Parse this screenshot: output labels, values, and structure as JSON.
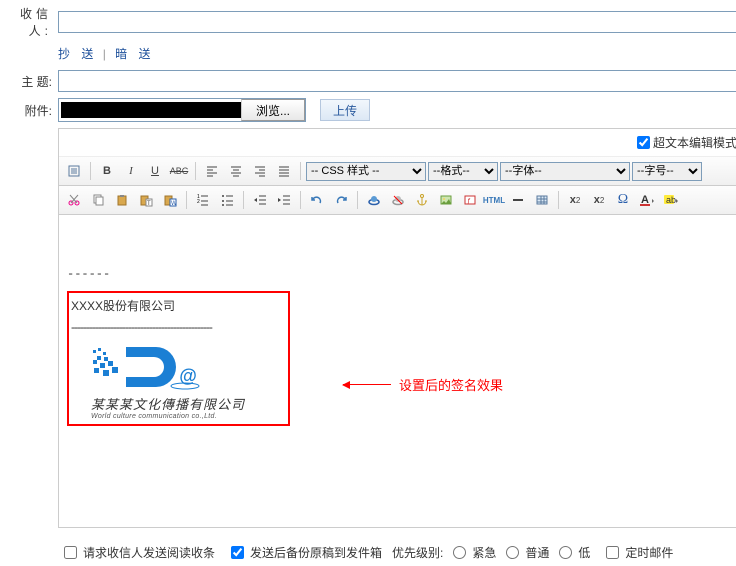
{
  "labels": {
    "to": "收信人:",
    "cc": "抄  送",
    "bcc": "暗  送",
    "subject": "主  题:",
    "attach": "附件:",
    "browse": "浏览...",
    "upload": "上传",
    "richtext": "超文本编辑模式"
  },
  "dropdowns": {
    "css": "-- CSS 样式 --",
    "format": "--格式--",
    "font": "--字体--",
    "size": "--字号--"
  },
  "content": {
    "dashes": "------",
    "company": "XXXX股份有限公司",
    "sigdash": "-----------------------------------------------",
    "chinese": "某某某文化傳播有限公司",
    "english": "World culture communication co.,Ltd.",
    "note": "设置后的签名效果"
  },
  "footer": {
    "receipt": "请求收信人发送阅读收条",
    "backup": "发送后备份原稿到发件箱",
    "priority_label": "优先级别:",
    "urgent": "紧急",
    "normal": "普通",
    "low": "低",
    "timed": "定时邮件"
  },
  "icons": {
    "paste": "paste",
    "bold": "B",
    "italic": "I",
    "underline": "U",
    "strike": "ABC"
  }
}
